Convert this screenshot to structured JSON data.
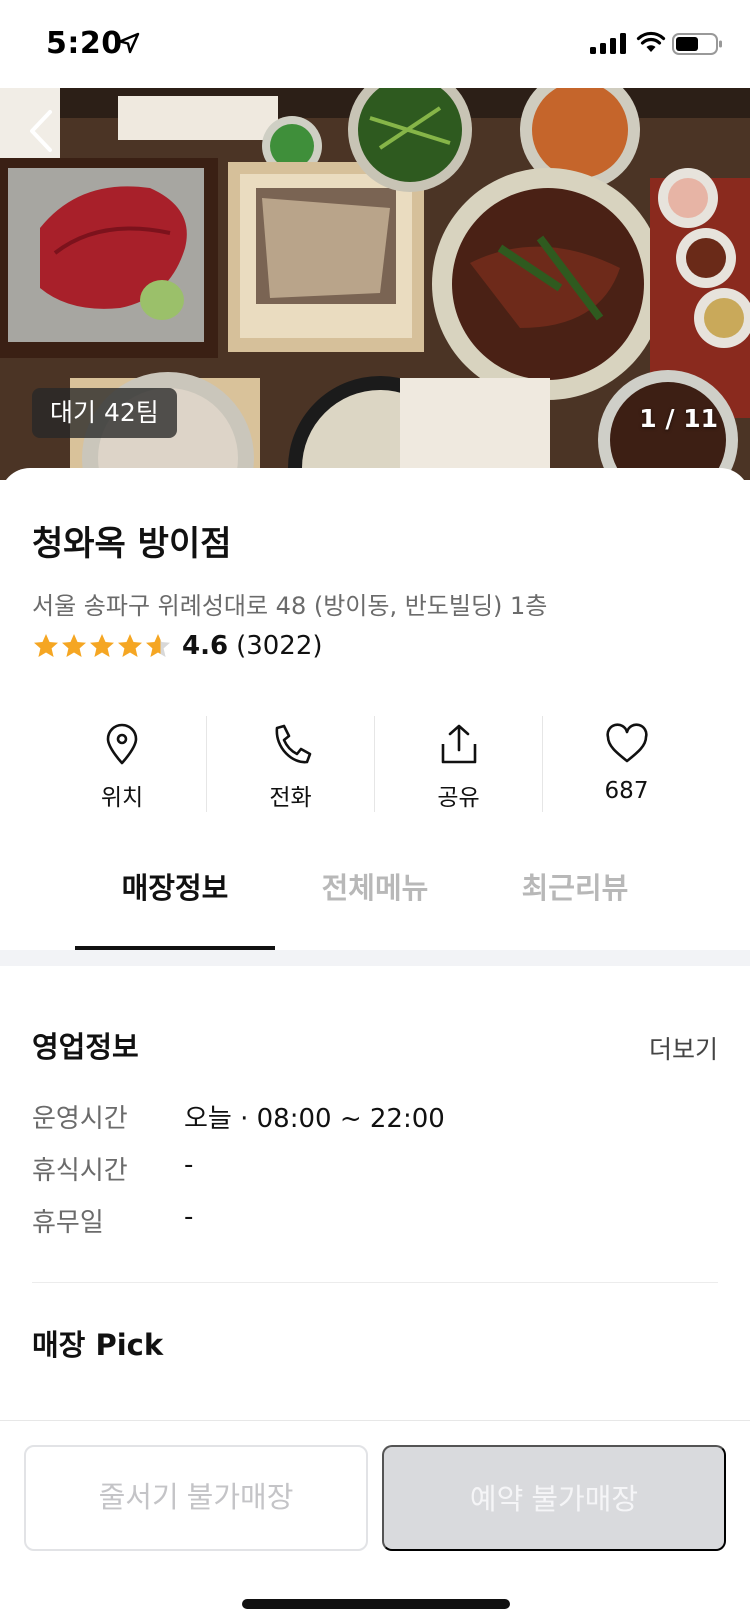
{
  "status_bar": {
    "time": "5:20",
    "location_icon": "location-arrow-icon",
    "signal_icon": "cellular-signal-icon",
    "wifi_icon": "wifi-icon",
    "battery_icon": "battery-icon"
  },
  "hero": {
    "back_icon": "chevron-left-icon",
    "wait_badge": "대기 42팀",
    "page_counter": "1 / 11"
  },
  "store": {
    "name": "청와옥 방이점",
    "address": "서울 송파구 위례성대로 48 (방이동, 반도빌딩) 1층",
    "rating": 4.6,
    "rating_text": "4.6",
    "review_count": "(3022)",
    "star_color": "#f5a623"
  },
  "actions": [
    {
      "label": "위치",
      "icon": "map-pin-icon"
    },
    {
      "label": "전화",
      "icon": "phone-icon"
    },
    {
      "label": "공유",
      "icon": "share-icon"
    },
    {
      "label": "687",
      "icon": "heart-icon"
    }
  ],
  "tabs": [
    {
      "label": "매장정보",
      "active": true
    },
    {
      "label": "전체메뉴",
      "active": false
    },
    {
      "label": "최근리뷰",
      "active": false
    }
  ],
  "business_info": {
    "title": "영업정보",
    "more": "더보기",
    "rows": [
      {
        "label": "운영시간",
        "value": "오늘 · 08:00 ~ 22:00"
      },
      {
        "label": "휴식시간",
        "value": "-"
      },
      {
        "label": "휴무일",
        "value": "-"
      }
    ]
  },
  "pick": {
    "title": "매장 Pick"
  },
  "bottom": {
    "queue_button": "줄서기 불가매장",
    "reserve_button": "예약 불가매장"
  }
}
